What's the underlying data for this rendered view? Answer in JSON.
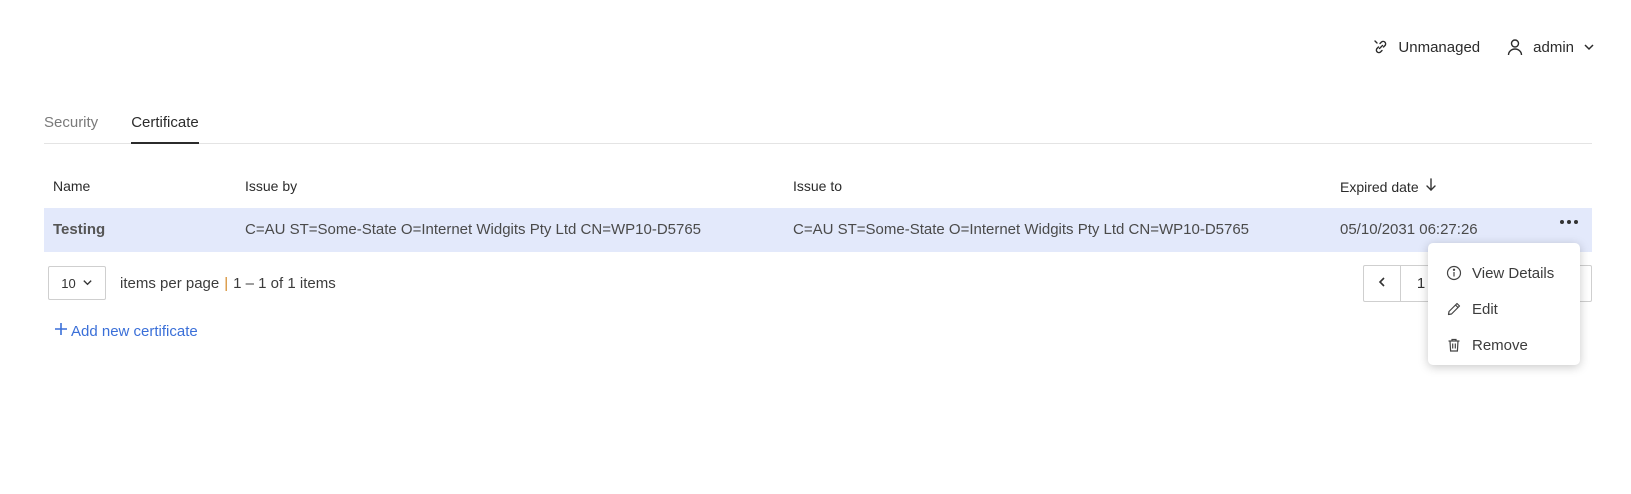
{
  "header": {
    "unmanaged_label": "Unmanaged",
    "user_label": "admin"
  },
  "tabs": [
    {
      "label": "Security",
      "active": false
    },
    {
      "label": "Certificate",
      "active": true
    }
  ],
  "table": {
    "columns": [
      "Name",
      "Issue by",
      "Issue to",
      "Expired date"
    ],
    "sort": {
      "column": "Expired date",
      "direction": "descending"
    },
    "rows": [
      {
        "name": "Testing",
        "issue_by": "C=AU ST=Some-State O=Internet Widgits Pty Ltd CN=WP10-D5765",
        "issue_to": "C=AU ST=Some-State O=Internet Widgits Pty Ltd CN=WP10-D5765",
        "expired_date": "05/10/2031 06:27:26",
        "selected": true
      }
    ]
  },
  "pagination": {
    "page_size": "10",
    "items_per_page_label": "items per page",
    "separator": "|",
    "range_text": "1 – 1 of 1 items",
    "current_page": "1"
  },
  "add_certificate_label": "Add new certificate",
  "context_menu": {
    "items": [
      {
        "label": "View Details",
        "icon": "info-icon"
      },
      {
        "label": "Edit",
        "icon": "pencil-icon"
      },
      {
        "label": "Remove",
        "icon": "trash-icon"
      }
    ]
  },
  "colors": {
    "selected_row": "#e3e9fb",
    "link": "#3a6fd8",
    "separator": "#d58a2a"
  }
}
